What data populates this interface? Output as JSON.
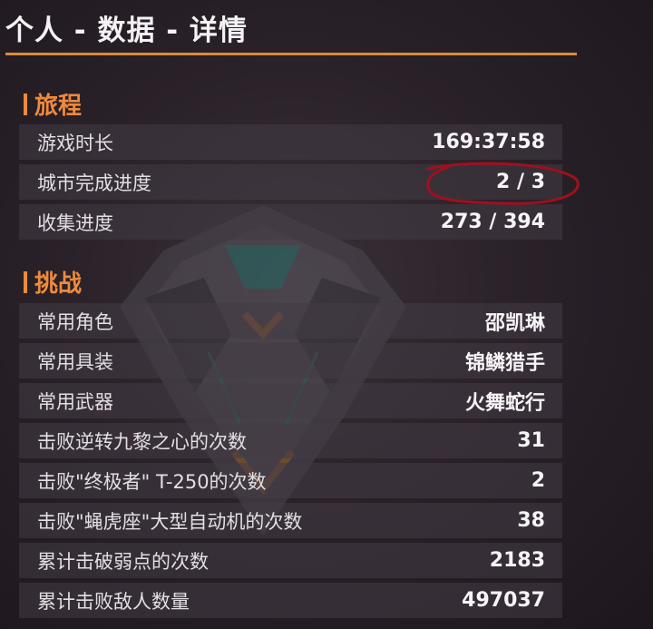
{
  "page": {
    "title": "个人 - 数据 - 详情"
  },
  "sections": [
    {
      "heading": "旅程",
      "rows": [
        {
          "label": "游戏时长",
          "value": "169:37:58"
        },
        {
          "label": "城市完成进度",
          "value": "2 / 3"
        },
        {
          "label": "收集进度",
          "value": "273 / 394"
        }
      ]
    },
    {
      "heading": "挑战",
      "rows": [
        {
          "label": "常用角色",
          "value": "邵凯琳"
        },
        {
          "label": "常用具装",
          "value": "锦鳞猎手"
        },
        {
          "label": "常用武器",
          "value": "火舞蛇行"
        },
        {
          "label": "击败逆转九黎之心的次数",
          "value": "31"
        },
        {
          "label": "击败\"终极者\" T-250的次数",
          "value": "2"
        },
        {
          "label": "击败\"蝇虎座\"大型自动机的次数",
          "value": "38"
        },
        {
          "label": "累计击破弱点的次数",
          "value": "2183"
        },
        {
          "label": "累计击败敌人数量",
          "value": "497037"
        }
      ]
    }
  ],
  "colors": {
    "accent": "#ee8a3c",
    "title_line": "#d98a3f",
    "annotation": "#a0101c",
    "emblem_teal": "#2f7f78"
  },
  "icons": [
    "diamond-emblem-icon"
  ]
}
